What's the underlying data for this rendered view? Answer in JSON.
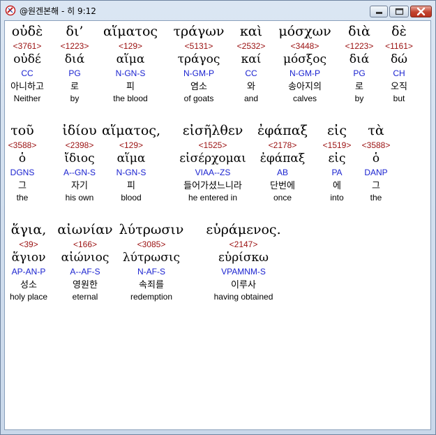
{
  "window": {
    "title": "@원겐본해 - 히 9:12",
    "icon": "app-logo-icon",
    "buttons": {
      "minimize": "minimize-icon",
      "maximize": "maximize-icon",
      "close": "close-icon"
    }
  },
  "rows": [
    {
      "words": [
        {
          "greek": "οὐδὲ",
          "strong": "<3761>",
          "lemma": "οὐδέ",
          "parse": "CC",
          "korean": "아니하고",
          "english": "Neither"
        },
        {
          "greek": "δι’",
          "strong": "<1223>",
          "lemma": "διά",
          "parse": "PG",
          "korean": "로",
          "english": "by"
        },
        {
          "greek": "αἵματος",
          "strong": "<129>",
          "lemma": "αἵμα",
          "parse": "N-GN-S",
          "korean": "피",
          "english": "the blood"
        },
        {
          "greek": "τράγων",
          "strong": "<5131>",
          "lemma": "τράγος",
          "parse": "N-GM-P",
          "korean": "염소",
          "english": "of goats"
        },
        {
          "greek": "καὶ",
          "strong": "<2532>",
          "lemma": "καί",
          "parse": "CC",
          "korean": "와",
          "english": "and"
        },
        {
          "greek": "μόσχων",
          "strong": "<3448>",
          "lemma": "μόσξος",
          "parse": "N-GM-P",
          "korean": "송아지의",
          "english": "calves"
        },
        {
          "greek": "διὰ",
          "strong": "<1223>",
          "lemma": "διά",
          "parse": "PG",
          "korean": "로",
          "english": "by"
        },
        {
          "greek": "δὲ",
          "strong": "<1161>",
          "lemma": "δώ",
          "parse": "CH",
          "korean": "오직",
          "english": "but"
        }
      ]
    },
    {
      "words": [
        {
          "greek": "τοῦ",
          "strong": "<3588>",
          "lemma": "ὁ",
          "parse": "DGNS",
          "korean": "그",
          "english": "the"
        },
        {
          "greek": "ἰδίου",
          "strong": "<2398>",
          "lemma": "ἴδιος",
          "parse": "A--GN-S",
          "korean": "자기",
          "english": "his own"
        },
        {
          "greek": "αἵματος,",
          "strong": "<129>",
          "lemma": "αἵμα",
          "parse": "N-GN-S",
          "korean": "피",
          "english": "blood"
        },
        {
          "greek": "εἰσῆλθεν",
          "strong": "<1525>",
          "lemma": "εἰσέρχομαι",
          "parse": "VIAA--ZS",
          "korean": "들어가셨느니라",
          "english": "he entered in"
        },
        {
          "greek": "ἐφάπαξ",
          "strong": "<2178>",
          "lemma": "ἐφάπαξ",
          "parse": "AB",
          "korean": "단번에",
          "english": "once"
        },
        {
          "greek": "εἰς",
          "strong": "<1519>",
          "lemma": "εἰς",
          "parse": "PA",
          "korean": "에",
          "english": "into"
        },
        {
          "greek": "τὰ",
          "strong": "<3588>",
          "lemma": "ὁ",
          "parse": "DANP",
          "korean": "그",
          "english": "the"
        }
      ]
    },
    {
      "words": [
        {
          "greek": "ἅγια,",
          "strong": "<39>",
          "lemma": "ἅγιον",
          "parse": "AP-AN-P",
          "korean": "성소",
          "english": "holy place"
        },
        {
          "greek": "αἰωνίαν",
          "strong": "<166>",
          "lemma": "αἰώνιος",
          "parse": "A--AF-S",
          "korean": "영원한",
          "english": "eternal"
        },
        {
          "greek": "λύτρωσιν",
          "strong": "<3085>",
          "lemma": "λύτρωσις",
          "parse": "N-AF-S",
          "korean": "속죄를",
          "english": "redemption"
        },
        {
          "greek": "εὑράμενος.",
          "strong": "<2147>",
          "lemma": "εὑρίσκω",
          "parse": "VPAMNM-S",
          "korean": "이루사",
          "english": "having obtained"
        }
      ]
    }
  ],
  "colors": {
    "strong": "#9a1010",
    "parse": "#1a22d0"
  }
}
